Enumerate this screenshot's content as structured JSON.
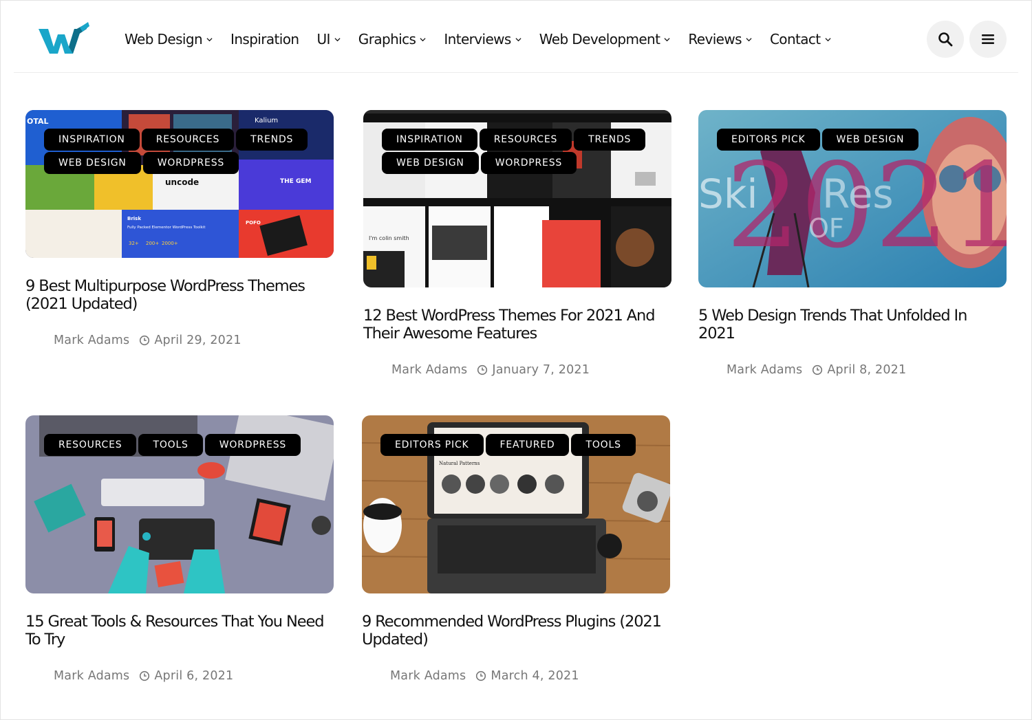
{
  "nav": {
    "items": [
      {
        "label": "Web Design",
        "dropdown": true
      },
      {
        "label": "Inspiration",
        "dropdown": false
      },
      {
        "label": "UI",
        "dropdown": true
      },
      {
        "label": "Graphics",
        "dropdown": true
      },
      {
        "label": "Interviews",
        "dropdown": true
      },
      {
        "label": "Web Development",
        "dropdown": true
      },
      {
        "label": "Reviews",
        "dropdown": true
      },
      {
        "label": "Contact",
        "dropdown": true
      }
    ]
  },
  "header_icons": [
    "search-icon",
    "menu-icon"
  ],
  "colors": {
    "logo_teal": "#1aa6c9",
    "logo_dark": "#0e6f8a",
    "tag_bg": "#000000",
    "meta_text": "#777777"
  },
  "posts": [
    {
      "tags": [
        "INSPIRATION",
        "RESOURCES",
        "TRENDS",
        "WEB DESIGN",
        "WORDPRESS"
      ],
      "title": "9 Best Multipurpose WordPress Themes (2021 Updated)",
      "author": "Mark Adams",
      "date": "April 29, 2021",
      "image_text": {
        "t1": "OTAL",
        "t2": "Kalium",
        "t3": "uncode",
        "t4": "THE GEM",
        "t5": "Brisk",
        "t6": "Fully Packed Elementor WordPress Toolkit",
        "t7": "32+",
        "t8": "200+",
        "t9": "2000+",
        "t10": "POFO"
      }
    },
    {
      "tags": [
        "INSPIRATION",
        "RESOURCES",
        "TRENDS",
        "WEB DESIGN",
        "WORDPRESS"
      ],
      "title": "12 Best WordPress Themes For 2021 And Their Awesome Features",
      "author": "Mark Adams",
      "date": "January 7, 2021",
      "image_text": {
        "t1": "I'm colin smith"
      }
    },
    {
      "tags": [
        "EDITORS PICK",
        "WEB DESIGN"
      ],
      "title": "5 Web Design Trends That Unfolded In 2021",
      "author": "Mark Adams",
      "date": "April 8, 2021",
      "image_text": {
        "t1": "2021",
        "t2": "Ski",
        "t3": "Res",
        "t4": "OF"
      }
    },
    {
      "tags": [
        "RESOURCES",
        "TOOLS",
        "WORDPRESS"
      ],
      "title": "15 Great Tools & Resources That You Need To Try",
      "author": "Mark Adams",
      "date": "April 6, 2021",
      "image_text": {}
    },
    {
      "tags": [
        "EDITORS PICK",
        "FEATURED",
        "TOOLS"
      ],
      "title": "9 Recommended WordPress Plugins (2021 Updated)",
      "author": "Mark Adams",
      "date": "March 4, 2021",
      "image_text": {
        "t1": "Natural Patterns"
      }
    }
  ]
}
